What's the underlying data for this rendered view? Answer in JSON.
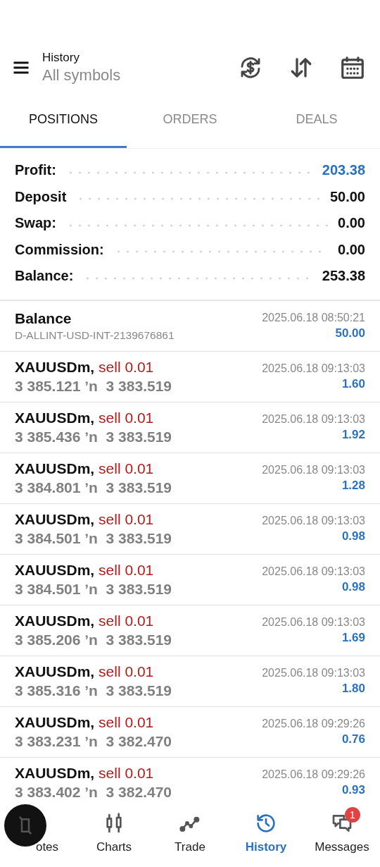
{
  "header": {
    "title": "History",
    "subtitle": "All symbols"
  },
  "tabs": [
    {
      "label": "POSITIONS",
      "selected": true
    },
    {
      "label": "ORDERS",
      "selected": false
    },
    {
      "label": "DEALS",
      "selected": false
    }
  ],
  "summary": [
    {
      "label": "Profit:",
      "value": "203.38",
      "highlight": true
    },
    {
      "label": "Deposit",
      "value": "50.00",
      "highlight": false
    },
    {
      "label": "Swap:",
      "value": "0.00",
      "highlight": false
    },
    {
      "label": "Commission:",
      "value": "0.00",
      "highlight": false
    },
    {
      "label": "Balance:",
      "value": "253.38",
      "highlight": false
    }
  ],
  "entries": [
    {
      "kind": "balance",
      "title": "Balance",
      "detail": "D-ALLINT-USD-INT-2139676861",
      "time": "2025.06.18 08:50:21",
      "amount": "50.00"
    },
    {
      "kind": "deal",
      "symbol": "XAUUSDm,",
      "side": "sell 0.01",
      "prices": "3 385.121 ʼn  3 383.519",
      "time": "2025.06.18 09:13:03",
      "amount": "1.60"
    },
    {
      "kind": "deal",
      "symbol": "XAUUSDm,",
      "side": "sell 0.01",
      "prices": "3 385.436 ʼn  3 383.519",
      "time": "2025.06.18 09:13:03",
      "amount": "1.92"
    },
    {
      "kind": "deal",
      "symbol": "XAUUSDm,",
      "side": "sell 0.01",
      "prices": "3 384.801 ʼn  3 383.519",
      "time": "2025.06.18 09:13:03",
      "amount": "1.28"
    },
    {
      "kind": "deal",
      "symbol": "XAUUSDm,",
      "side": "sell 0.01",
      "prices": "3 384.501 ʼn  3 383.519",
      "time": "2025.06.18 09:13:03",
      "amount": "0.98"
    },
    {
      "kind": "deal",
      "symbol": "XAUUSDm,",
      "side": "sell 0.01",
      "prices": "3 384.501 ʼn  3 383.519",
      "time": "2025.06.18 09:13:03",
      "amount": "0.98"
    },
    {
      "kind": "deal",
      "symbol": "XAUUSDm,",
      "side": "sell 0.01",
      "prices": "3 385.206 ʼn  3 383.519",
      "time": "2025.06.18 09:13:03",
      "amount": "1.69"
    },
    {
      "kind": "deal",
      "symbol": "XAUUSDm,",
      "side": "sell 0.01",
      "prices": "3 385.316 ʼn  3 383.519",
      "time": "2025.06.18 09:13:03",
      "amount": "1.80"
    },
    {
      "kind": "deal",
      "symbol": "XAUUSDm,",
      "side": "sell 0.01",
      "prices": "3 383.231 ʼn  3 382.470",
      "time": "2025.06.18 09:29:26",
      "amount": "0.76"
    },
    {
      "kind": "deal",
      "symbol": "XAUUSDm,",
      "side": "sell 0.01",
      "prices": "3 383.402 ʼn  3 382.470",
      "time": "2025.06.18 09:29:26",
      "amount": "0.93"
    }
  ],
  "nav": [
    {
      "label": "otes",
      "selected": false
    },
    {
      "label": "Charts",
      "selected": false
    },
    {
      "label": "Trade",
      "selected": false
    },
    {
      "label": "History",
      "selected": true
    },
    {
      "label": "Messages",
      "selected": false,
      "badge": "1"
    }
  ]
}
